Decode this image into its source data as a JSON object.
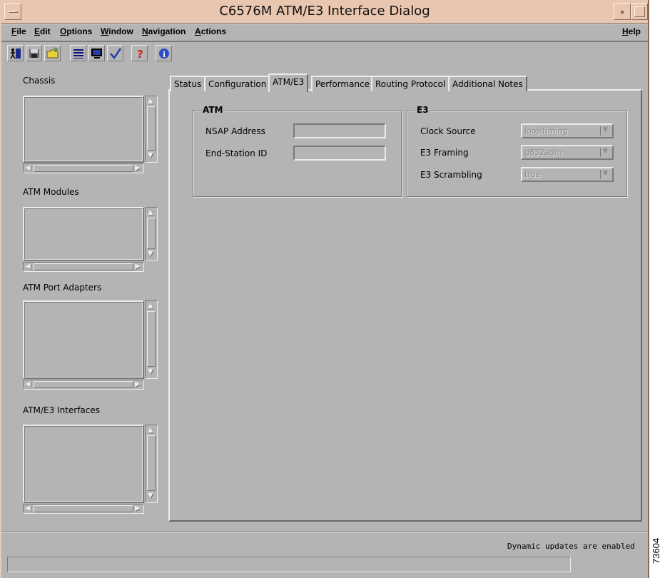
{
  "window": {
    "title": "C6576M ATM/E3 Interface Dialog"
  },
  "menubar": {
    "items": [
      "File",
      "Edit",
      "Options",
      "Window",
      "Navigation",
      "Actions"
    ],
    "help": "Help"
  },
  "toolbar": {
    "icons": [
      "exit-icon",
      "save-icon",
      "open-folder-icon",
      "list-icon",
      "monitor-icon",
      "checkmark-icon",
      "help-question-icon",
      "info-icon"
    ]
  },
  "left_panels": {
    "chassis": "Chassis",
    "atm_modules": "ATM Modules",
    "atm_port_adapters": "ATM Port Adapters",
    "atm_e3_interfaces": "ATM/E3 Interfaces"
  },
  "tabs": [
    "Status",
    "Configuration",
    "ATM/E3",
    "Performance",
    "Routing Protocol",
    "Additional Notes"
  ],
  "active_tab": "ATM/E3",
  "atm_group": {
    "title": "ATM",
    "nsap_label": "NSAP Address",
    "nsap_value": "",
    "end_station_label": "End-Station ID",
    "end_station_value": ""
  },
  "e3_group": {
    "title": "E3",
    "clock_source_label": "Clock Source",
    "clock_source_value": "loopTiming",
    "framing_label": "E3 Framing",
    "framing_value": "g832adm",
    "scrambling_label": "E3 Scrambling",
    "scrambling_value": "true"
  },
  "status": {
    "message": "Dynamic updates are enabled",
    "figure_id": "73604"
  }
}
